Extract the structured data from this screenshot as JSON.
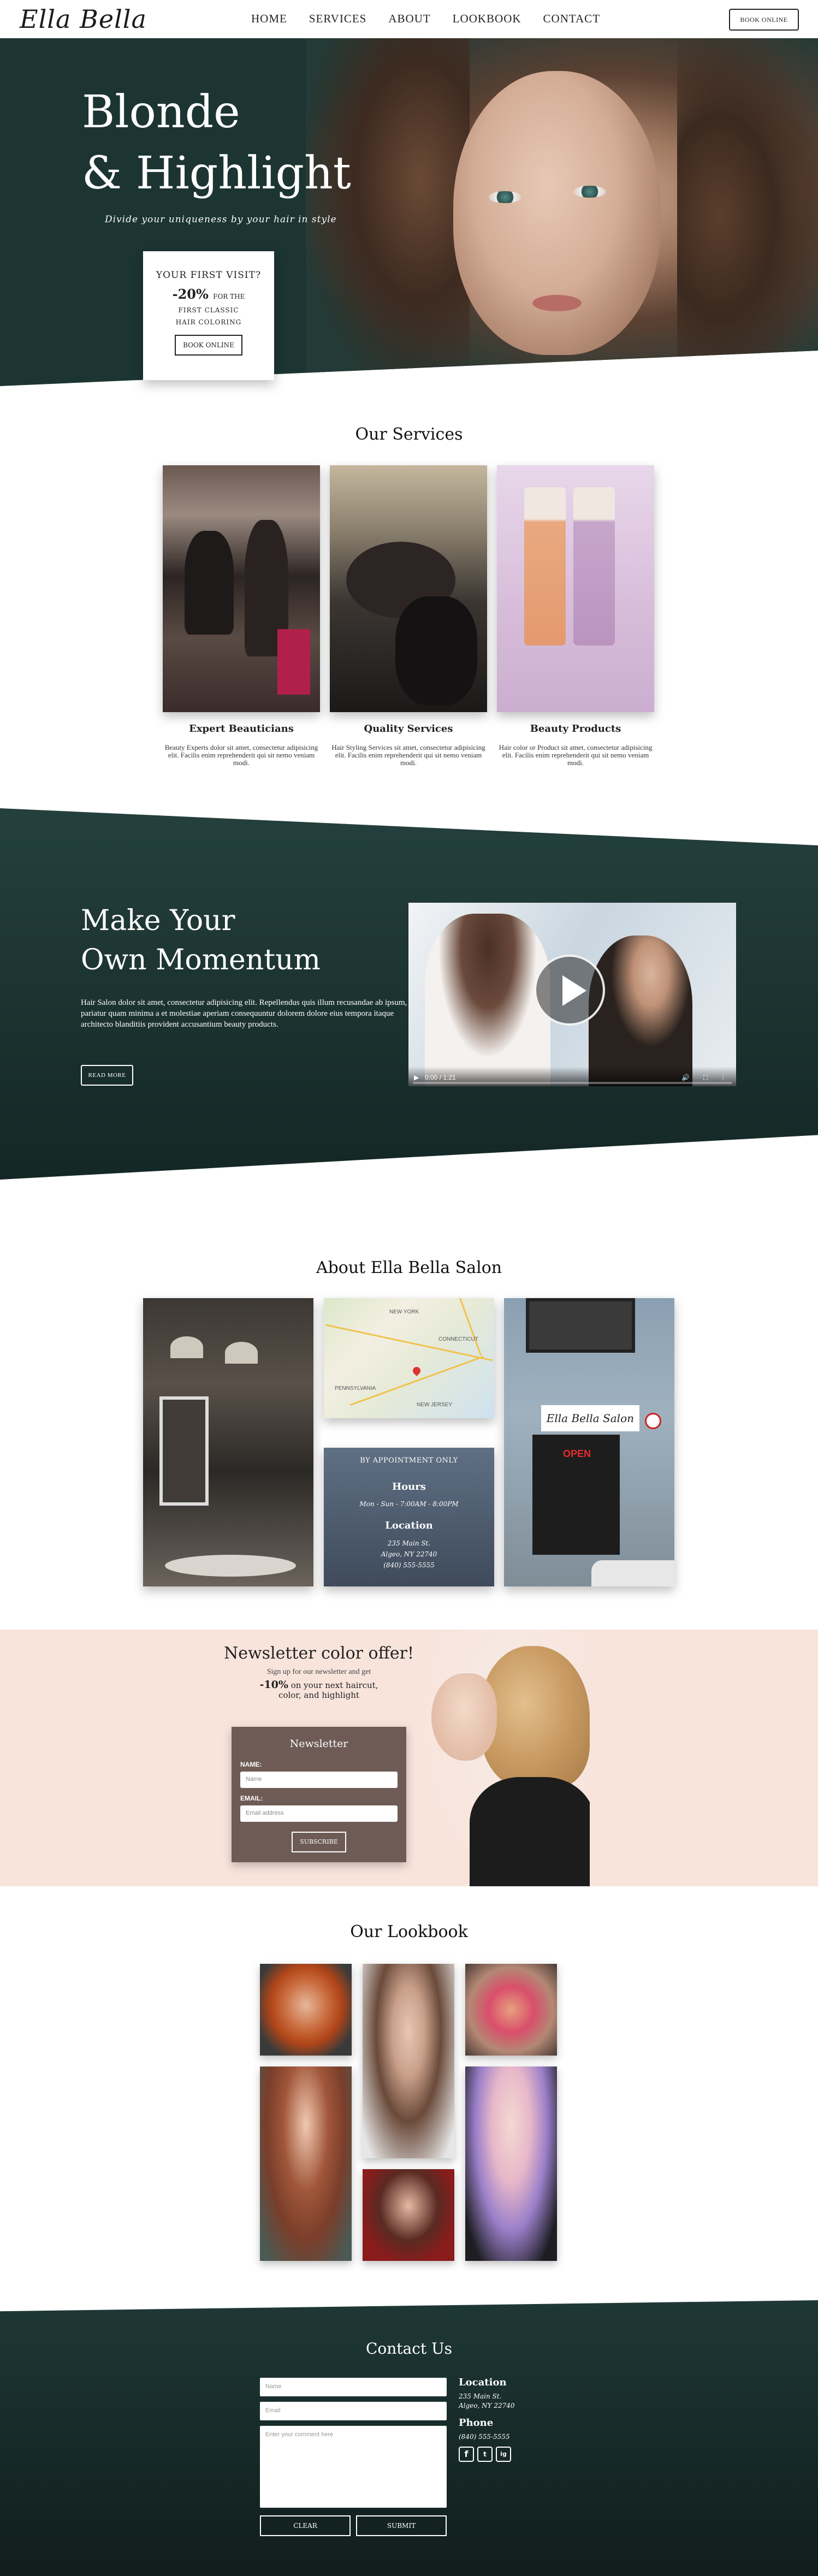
{
  "header": {
    "logo": "Ella Bella",
    "nav": [
      "HOME",
      "SERVICES",
      "ABOUT",
      "LOOKBOOK",
      "CONTACT"
    ],
    "book_button": "BOOK ONLINE"
  },
  "hero": {
    "title_line1": "Blonde",
    "title_line2": "& Highlight",
    "subtitle": "Divide your uniqueness by your hair in style",
    "promo": {
      "line1": "YOUR FIRST VISIT?",
      "discount": "-20%",
      "discount_suffix": "FOR THE",
      "line3": "FIRST CLASSIC",
      "line4": "HAIR COLORING",
      "button": "BOOK ONLINE"
    }
  },
  "services": {
    "title": "Our Services",
    "items": [
      {
        "name": "Expert Beauticians",
        "desc": "Beauty Experts dolor sit amet, consectetur adipisicing elit. Facilis enim reprehenderit qui sit nemo veniam modi."
      },
      {
        "name": "Quality Services",
        "desc": "Hair Styling Services sit amet, consectetur adipisicing elit. Facilis enim reprehenderit qui sit nemo veniam modi."
      },
      {
        "name": "Beauty Products",
        "desc": "Hair color or Product sit amet, consectetur adipisicing elit. Facilis enim reprehenderit qui sit nemo veniam modi."
      }
    ]
  },
  "momentum": {
    "title_line1": "Make Your",
    "title_line2": "Own Momentum",
    "text": "Hair Salon dolor sit amet, consectetur adipisicing elit. Repellendus quis illum recusandae ab ipsum, pariatur quam minima a et molestiae aperiam consequuntur dolorem dolore eius tempora itaque architecto blanditiis provident accusantium beauty products.",
    "button": "READ MORE",
    "video_time": "0:00 / 1:21"
  },
  "about": {
    "title": "About Ella Bella Salon",
    "appointment": "BY APPOINTMENT ONLY",
    "hours_heading": "Hours",
    "hours": "Mon - Sun - 7:00AM - 8:00PM",
    "location_heading": "Location",
    "address1": "235 Main St.",
    "address2": "Algeo, NY 22740",
    "phone": "(840) 555-5555",
    "salon_sign": "Ella Bella Salon",
    "open_sign": "OPEN",
    "map_labels": [
      "NEW YORK",
      "CONNECTICUT",
      "PENNSYLVANIA",
      "NEW JERSEY"
    ]
  },
  "newsletter": {
    "title": "Newsletter color offer!",
    "line1": "Sign up for our newsletter and get",
    "offer": "-10%",
    "offer_suffix": "on your next haircut,",
    "offer_line2": "color, and highlight",
    "form_title": "Newsletter",
    "name_label": "NAME:",
    "name_placeholder": "Name",
    "email_label": "EMAIL:",
    "email_placeholder": "Email address",
    "button": "SUBSCRIBE"
  },
  "lookbook": {
    "title": "Our Lookbook"
  },
  "contact": {
    "title": "Contact Us",
    "name_placeholder": "Name",
    "email_placeholder": "Email",
    "comment_placeholder": "Enter your comment here",
    "clear_button": "CLEAR",
    "submit_button": "SUBMIT",
    "location_heading": "Location",
    "address1": "235 Main St.",
    "address2": "Algeo, NY 22740",
    "phone_heading": "Phone",
    "phone": "(840) 555-5555",
    "social": [
      "f",
      "t",
      "ig"
    ]
  }
}
